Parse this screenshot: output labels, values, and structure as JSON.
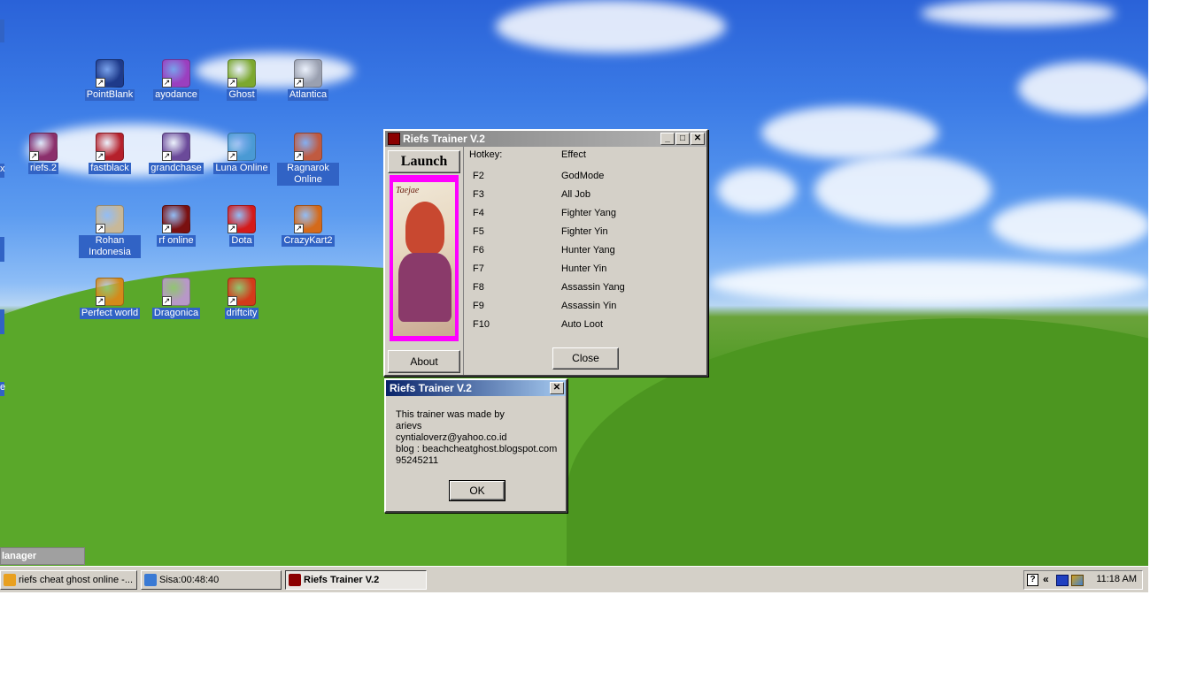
{
  "desktop": {
    "icons": [
      {
        "label": "PointBlank",
        "color": "#1e3a8a"
      },
      {
        "label": "ayodance",
        "color": "#9b3fbf"
      },
      {
        "label": "Ghost",
        "color": "#7ca82e"
      },
      {
        "label": "Atlantica",
        "color": "#9aa0b0"
      },
      {
        "label": "riefs.2",
        "color": "#8b2f6b"
      },
      {
        "label": "fastblack",
        "color": "#b5202b"
      },
      {
        "label": "grandchase",
        "color": "#6b4a9a"
      },
      {
        "label": "Luna Online",
        "color": "#4a9ad4"
      },
      {
        "label": "Ragnarok Online",
        "color": "#c05a40"
      },
      {
        "label": "Rohan Indonesia",
        "color": "#c8b898"
      },
      {
        "label": "rf online",
        "color": "#7a1010"
      },
      {
        "label": "Dota",
        "color": "#d41a1a"
      },
      {
        "label": "CrazyKart2",
        "color": "#d46a1a"
      },
      {
        "label": "Perfect world",
        "color": "#d48a1a"
      },
      {
        "label": "Dragonica",
        "color": "#b898c8"
      },
      {
        "label": "driftcity",
        "color": "#d43a1a"
      }
    ],
    "left_edge": {
      "partial_label_1": "x",
      "partial_label_2": "e"
    },
    "manager_label": "lanager"
  },
  "trainer_window": {
    "title": "Riefs Trainer V.2",
    "launch_label": "Launch",
    "image_caption": "Taejae",
    "about_label": "About",
    "close_label": "Close",
    "header_hotkey": "Hotkey:",
    "header_effect": "Effect",
    "hotkeys": [
      {
        "key": "F2",
        "effect": "GodMode"
      },
      {
        "key": "F3",
        "effect": "All Job"
      },
      {
        "key": "F4",
        "effect": "Fighter Yang"
      },
      {
        "key": "F5",
        "effect": "Fighter Yin"
      },
      {
        "key": "F6",
        "effect": "Hunter Yang"
      },
      {
        "key": "F7",
        "effect": "Hunter Yin"
      },
      {
        "key": "F8",
        "effect": "Assassin Yang"
      },
      {
        "key": "F9",
        "effect": "Assassin Yin"
      },
      {
        "key": "F10",
        "effect": "Auto Loot"
      }
    ]
  },
  "about_dialog": {
    "title": "Riefs Trainer V.2",
    "lines": [
      "This trainer was made by",
      "arievs",
      "cyntialoverz@yahoo.co.id",
      "blog : beachcheatghost.blogspot.com",
      "95245211"
    ],
    "ok_label": "OK"
  },
  "taskbar": {
    "tasks": [
      {
        "label": "riefs cheat ghost online -...",
        "color": "#e8a020"
      },
      {
        "label": "Sisa:00:48:40",
        "color": "#3a7ad4"
      },
      {
        "label": "Riefs Trainer V.2",
        "color": "#8b0000"
      }
    ],
    "tray": {
      "chevron": "«",
      "help": "?",
      "clock": "11:18 AM"
    }
  }
}
